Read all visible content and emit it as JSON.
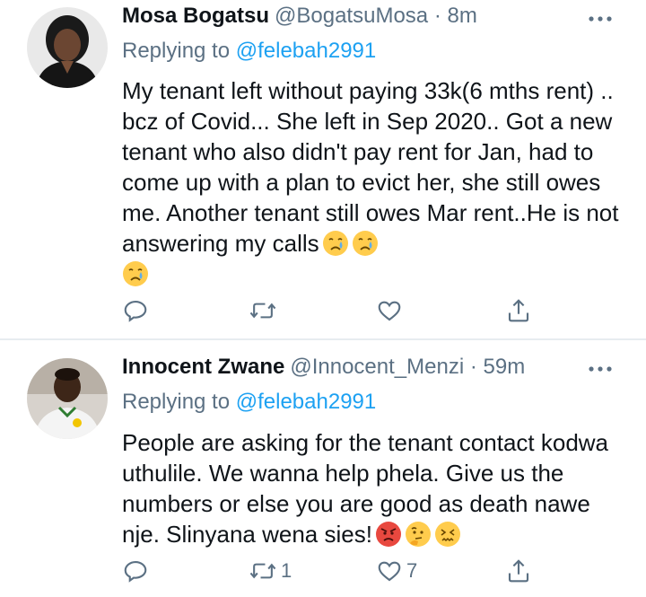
{
  "tweets": [
    {
      "name": "Mosa Bogatsu",
      "handle": "@BogatsuMosa",
      "separator": "·",
      "time": "8m",
      "replying_prefix": "Replying to",
      "replying_to": "@felebah2991",
      "text": "My tenant left without paying 33k(6 mths rent) .. bcz of Covid... She left in Sep 2020.. Got a new tenant who also didn't pay rent for Jan, had to come up with a plan to evict her, she still owes me. Another tenant still owes Mar rent..He is not answering my calls",
      "emojis": [
        "crying-face",
        "crying-face",
        "crying-face"
      ],
      "retweets": "",
      "likes": ""
    },
    {
      "name": "Innocent Zwane",
      "handle": "@Innocent_Menzi",
      "separator": "·",
      "time": "59m",
      "replying_prefix": "Replying to",
      "replying_to": "@felebah2991",
      "text": "People are asking for the tenant contact kodwa uthulile. We wanna help phela. Give us the numbers or else you are good as death nawe nje. Slinyana wena sies!",
      "emojis": [
        "angry-face",
        "thinking-face",
        "confounded-face"
      ],
      "retweets": "1",
      "likes": "7"
    }
  ],
  "icons": [
    "reply-icon",
    "retweet-icon",
    "like-icon",
    "share-icon",
    "more-icon"
  ],
  "colors": {
    "primary_text": "#0f1419",
    "secondary_text": "#5b7083",
    "link": "#1da1f2",
    "divider": "#e7ecf0"
  }
}
